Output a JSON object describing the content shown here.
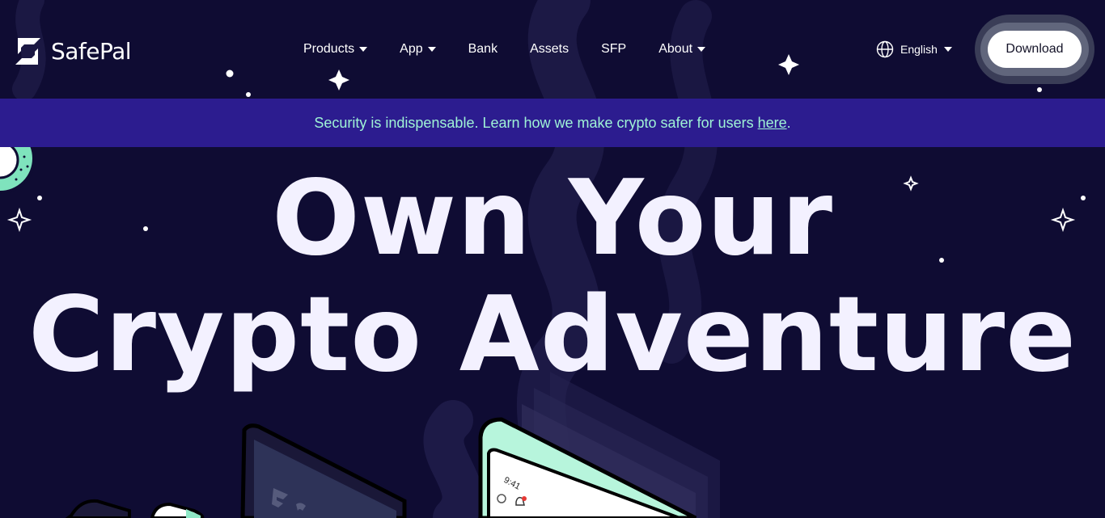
{
  "header": {
    "logo_text": "SafePal",
    "nav": [
      {
        "label": "Products",
        "has_dropdown": true
      },
      {
        "label": "App",
        "has_dropdown": true
      },
      {
        "label": "Bank",
        "has_dropdown": false
      },
      {
        "label": "Assets",
        "has_dropdown": false
      },
      {
        "label": "SFP",
        "has_dropdown": false
      },
      {
        "label": "About",
        "has_dropdown": true
      }
    ],
    "language": "English",
    "download_label": "Download"
  },
  "banner": {
    "text": "Security is indispensable. Learn how we make crypto safer for users ",
    "link_text": "here",
    "suffix": "."
  },
  "hero": {
    "headline_line1": "Own Your",
    "headline_line2": "Crypto Adventure"
  },
  "device": {
    "clock": "9:41"
  },
  "colors": {
    "background": "#0f0c33",
    "banner_bg": "#2c1c8f",
    "banner_text": "#9ff3d6",
    "headline": "#f3f1ff",
    "accent_mint": "#b7f5dc"
  }
}
